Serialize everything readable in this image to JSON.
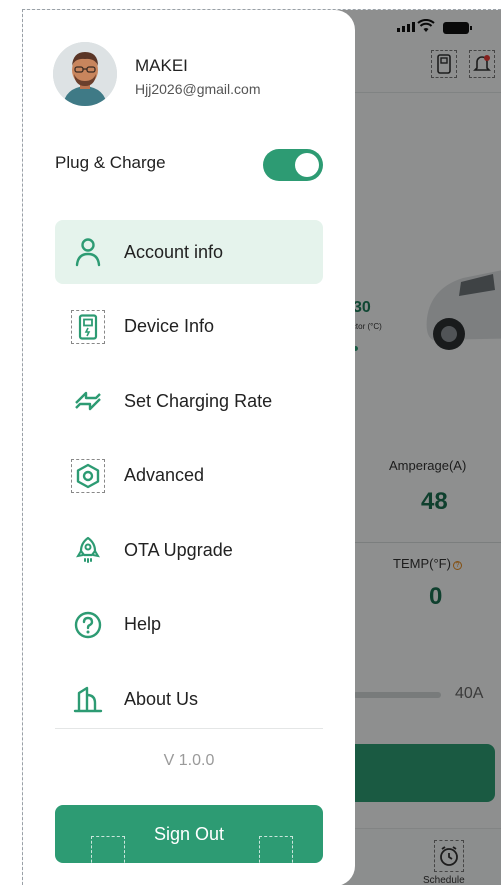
{
  "profile": {
    "name": "MAKEI",
    "email": "Hjj2026@gmail.com"
  },
  "plug_charge": {
    "label": "Plug & Charge",
    "enabled": true
  },
  "menu": [
    {
      "label": "Account info",
      "icon": "person-icon",
      "active": true
    },
    {
      "label": "Device Info",
      "icon": "charger-icon",
      "active": false
    },
    {
      "label": "Set Charging Rate",
      "icon": "swap-arrows-icon",
      "active": false
    },
    {
      "label": "Advanced",
      "icon": "hexagon-settings-icon",
      "active": false
    },
    {
      "label": "OTA Upgrade",
      "icon": "rocket-icon",
      "active": false
    },
    {
      "label": "Help",
      "icon": "question-circle-icon",
      "active": false
    },
    {
      "label": "About Us",
      "icon": "building-icon",
      "active": false
    }
  ],
  "version": "V 1.0.0",
  "sign_out_label": "Sign Out",
  "background": {
    "connector_value": "30",
    "connector_label": "nector (°C)",
    "amperage_label": "Amperage(A)",
    "amperage_value": "48",
    "temp_label": "TEMP(°F)",
    "temp_value": "0",
    "slider_max": "40A",
    "schedule_label": "Schedule"
  },
  "colors": {
    "accent": "#2d9b73",
    "active_bg": "#e5f3ec",
    "value_green": "#1b6e50"
  }
}
